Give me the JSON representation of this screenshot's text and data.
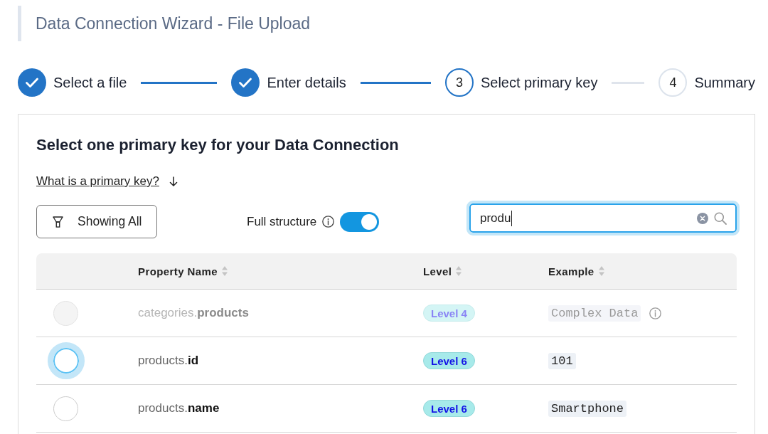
{
  "page": {
    "title": "Data Connection Wizard - File Upload"
  },
  "steps": [
    {
      "label": "Select a file",
      "completed": true,
      "current": false
    },
    {
      "label": "Enter details",
      "completed": true,
      "current": false
    },
    {
      "number": "3",
      "label": "Select primary key",
      "completed": false,
      "current": true
    },
    {
      "number": "4",
      "label": "Summary",
      "completed": false,
      "current": false
    }
  ],
  "panel": {
    "heading": "Select one primary key for your Data Connection",
    "help_link": "What is a primary key?",
    "filter_button": {
      "label": "Showing All"
    },
    "full_structure": {
      "label": "Full structure",
      "on": true
    },
    "search": {
      "value": "produ",
      "focused": true
    },
    "table": {
      "columns": [
        {
          "label": "Property Name",
          "sortable": true
        },
        {
          "label": "Level",
          "sortable": true
        },
        {
          "label": "Example",
          "sortable": true
        }
      ],
      "rows": [
        {
          "property": "categories.**products**",
          "level": "Level 4",
          "example": "Complex Data",
          "example_info": true,
          "disabled": true,
          "focused": false,
          "selected": false
        },
        {
          "property": "products.**id**",
          "level": "Level 6",
          "example": "101",
          "example_info": false,
          "disabled": false,
          "focused": true,
          "selected": false
        },
        {
          "property": "products.**name**",
          "level": "Level 6",
          "example": "Smartphone",
          "example_info": false,
          "disabled": false,
          "focused": false,
          "selected": false
        }
      ]
    }
  }
}
